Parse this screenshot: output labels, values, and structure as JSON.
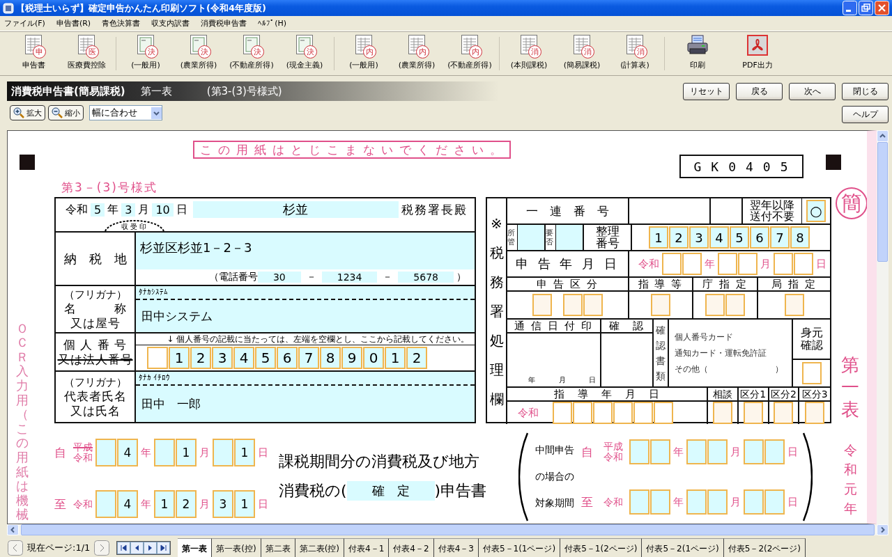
{
  "window": {
    "title": "【税理士いらず】確定申告かんたん印刷ソフト(令和4年度版)"
  },
  "menu": [
    "ファイル(F)",
    "申告書(R)",
    "青色決算書",
    "収支内訳書",
    "消費税申告書",
    "ﾍﾙﾌﾟ(H)"
  ],
  "toolbar": [
    [
      {
        "kind": "form",
        "stamp": "申",
        "label": "申告書"
      },
      {
        "kind": "form",
        "stamp": "医",
        "label": "医療費控除"
      }
    ],
    [
      {
        "kind": "ledger",
        "stamp": "決",
        "label": "(一般用)"
      },
      {
        "kind": "ledger",
        "stamp": "決",
        "label": "(農業所得)"
      },
      {
        "kind": "ledger",
        "stamp": "決",
        "label": "(不動産所得)"
      },
      {
        "kind": "ledger",
        "stamp": "決",
        "label": "(現金主義)"
      }
    ],
    [
      {
        "kind": "form",
        "stamp": "内",
        "label": "(一般用)"
      },
      {
        "kind": "form",
        "stamp": "内",
        "label": "(農業所得)"
      },
      {
        "kind": "form",
        "stamp": "内",
        "label": "(不動産所得)"
      }
    ],
    [
      {
        "kind": "form",
        "stamp": "消",
        "label": "(本則課税)"
      },
      {
        "kind": "form",
        "stamp": "消",
        "label": "(簡易課税)"
      },
      {
        "kind": "form",
        "stamp": "消",
        "label": "(計算表)"
      }
    ],
    [
      {
        "kind": "printer",
        "label": "印刷"
      },
      {
        "kind": "pdf",
        "label": "PDF出力"
      }
    ]
  ],
  "header": {
    "title": "消費税申告書(簡易課税)",
    "sheet": "第一表",
    "form_no": "(第3-(3)号様式)",
    "buttons": [
      "リセット",
      "戻る",
      "次へ",
      "閉じる"
    ],
    "help": "ヘルプ"
  },
  "zoom": {
    "zoom_in": "拡大",
    "zoom_out": "縮小",
    "fit": "幅に合わせ"
  },
  "form": {
    "notice": "この用紙はとじこまないでください。",
    "code": "GK0405",
    "form_label": "第3－(3)号様式",
    "ocr_note": "ＯＣＲ入力用（この用紙は機械",
    "kan_stamp": "簡",
    "sheet_label": "第一表",
    "era_label": "令和元年",
    "filing": {
      "era": "令和",
      "parts": [
        {
          "value": "5",
          "unit": "年"
        },
        {
          "value": "3",
          "unit": "月"
        },
        {
          "value": "10",
          "unit": "日"
        }
      ],
      "office": "杉並",
      "office_suffix": "税務署長殿",
      "stamp_label": "収受印"
    },
    "address": {
      "label": "納　税　地",
      "value": "杉並区杉並1－2－3",
      "phone_label": "（電話番号",
      "phone": [
        "30",
        "1234",
        "5678"
      ],
      "phone_seps": [
        "－",
        "－"
      ],
      "phone_close": "）"
    },
    "name": {
      "kana_label": "（フリガナ）",
      "kana": "ﾀﾅｶｼｽﾃﾑ",
      "label_lines": [
        "名　　　称",
        "又は屋号"
      ],
      "value": "田中システム"
    },
    "number": {
      "label_lines": [
        {
          "text": "個 人 番 号",
          "struck": false
        },
        {
          "text": "又は法人番号",
          "struck": true
        }
      ],
      "note": "↓ 個人番号の記載に当たっては、左端を空欄とし、ここから記載してください。",
      "digits": [
        "1",
        "2",
        "3",
        "4",
        "5",
        "6",
        "7",
        "8",
        "9",
        "0",
        "1",
        "2"
      ]
    },
    "rep": {
      "kana_label": "（フリガナ）",
      "kana": "ﾀﾅｶ ｲﾁﾛｳ",
      "label_lines": [
        "代表者氏名",
        "又は氏名"
      ],
      "value": "田中　一郎"
    },
    "office": {
      "side_label": "※税務署処理欄",
      "serial_label": "一　連　番　号",
      "no_send_label": "翌年以降送付不要",
      "no_send_mark": "○",
      "jurisdiction_label": "所管",
      "need_label": "要否",
      "ref_label": "整理番号",
      "ref_digits": [
        "1",
        "2",
        "3",
        "4",
        "5",
        "6",
        "7",
        "8"
      ],
      "date_label": "申 告 年 月 日",
      "date": {
        "era": "令和",
        "parts": [
          {
            "unit": "年"
          },
          {
            "unit": "月"
          },
          {
            "unit": "日"
          }
        ]
      },
      "categories": [
        {
          "label": "申 告 区 分"
        },
        {
          "label": "指 導 等"
        },
        {
          "label": "庁 指 定"
        },
        {
          "label": "局 指 定"
        }
      ],
      "comm_label": "通 信 日 付 印",
      "comm_units": [
        "年",
        "月",
        "日"
      ],
      "confirm_label": "確　認",
      "docs_label": "確認書類",
      "docs": [
        "個人番号カード",
        "通知カード・運転免許証",
        "その他（　　　　　　　　）"
      ],
      "id_label": "身元確認",
      "guidance_label": "指　導　年　月　日",
      "guidance_era": "令和",
      "columns": [
        "相談",
        "区分1",
        "区分2",
        "区分3"
      ]
    },
    "period": {
      "from": {
        "label": "自",
        "eras": [
          {
            "text": "平成",
            "struck": true
          },
          {
            "text": "令和",
            "struck": false
          }
        ],
        "parts": [
          {
            "value": [
              "4"
            ],
            "unit": "年"
          },
          {
            "value": [
              "1"
            ],
            "unit": "月"
          },
          {
            "value": [
              "1"
            ],
            "unit": "日"
          }
        ]
      },
      "to": {
        "label": "至",
        "eras": [
          {
            "text": "令和",
            "struck": false
          }
        ],
        "parts": [
          {
            "value": [
              "4"
            ],
            "unit": "年"
          },
          {
            "value": [
              "1",
              "2"
            ],
            "unit": "月"
          },
          {
            "value": [
              "3",
              "1"
            ],
            "unit": "日"
          }
        ]
      }
    },
    "title_line": "課税期間分の消費税及び地方",
    "title_prefix": "消費税の(",
    "title_value": "確　定",
    "title_suffix": ")申告書",
    "interim": {
      "label_lines": [
        "中間申告",
        "の場合の",
        "対象期間"
      ],
      "from": {
        "label": "自",
        "eras": [
          {
            "text": "平成",
            "struck": false
          },
          {
            "text": "令和",
            "struck": false
          }
        ],
        "parts": [
          {
            "unit": "年"
          },
          {
            "unit": "月"
          },
          {
            "unit": "日"
          }
        ]
      },
      "to": {
        "label": "至",
        "eras": [
          {
            "text": "令和",
            "struck": false
          }
        ],
        "parts": [
          {
            "unit": "年"
          },
          {
            "unit": "月"
          },
          {
            "unit": "日"
          }
        ]
      }
    }
  },
  "pager": {
    "page": "現在ページ:1/1"
  },
  "tabs": [
    {
      "label": "第一表",
      "selected": true
    },
    {
      "label": "第一表(控)",
      "selected": false
    },
    {
      "label": "第二表",
      "selected": false
    },
    {
      "label": "第二表(控)",
      "selected": false
    },
    {
      "label": "付表4－1",
      "selected": false
    },
    {
      "label": "付表4－2",
      "selected": false
    },
    {
      "label": "付表4－3",
      "selected": false
    },
    {
      "label": "付表5－1(1ページ)",
      "selected": false
    },
    {
      "label": "付表5－1(2ページ)",
      "selected": false
    },
    {
      "label": "付表5－2(1ページ)",
      "selected": false
    },
    {
      "label": "付表5－2(2ページ)",
      "selected": false
    }
  ]
}
